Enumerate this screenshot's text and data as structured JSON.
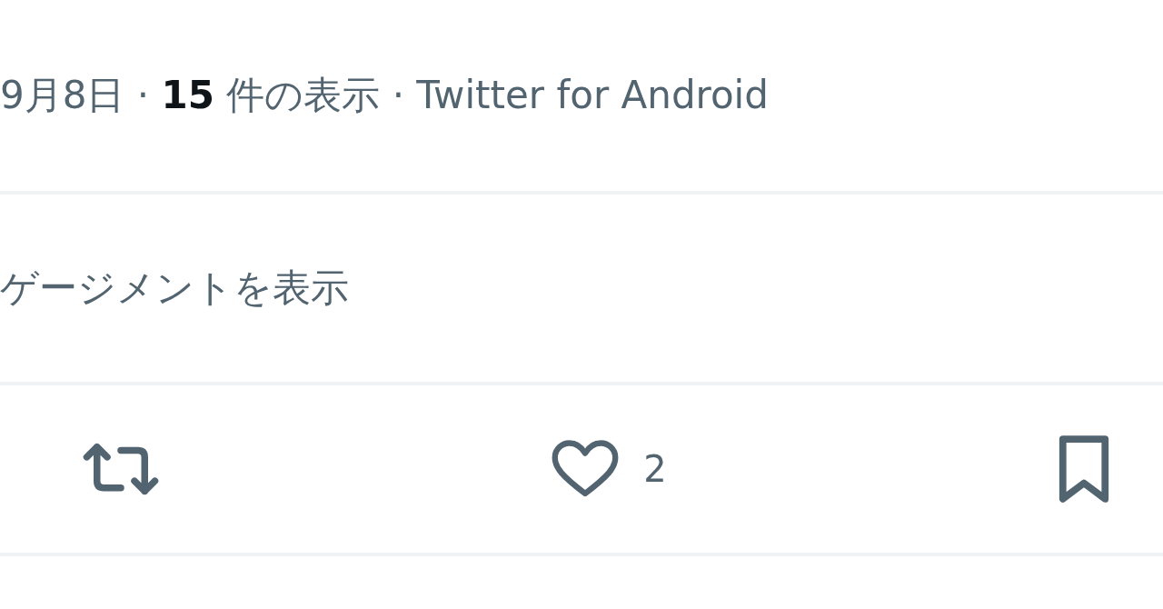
{
  "meta": "9月8日 · **15** 件の表示 · Twitter for Android",
  "engagement_link": "ゲージメントを表示",
  "actions": [
    {
      "kind": "retweet"
    },
    {
      "kind": "like",
      "count": "2"
    },
    {
      "kind": "bookmark"
    }
  ]
}
